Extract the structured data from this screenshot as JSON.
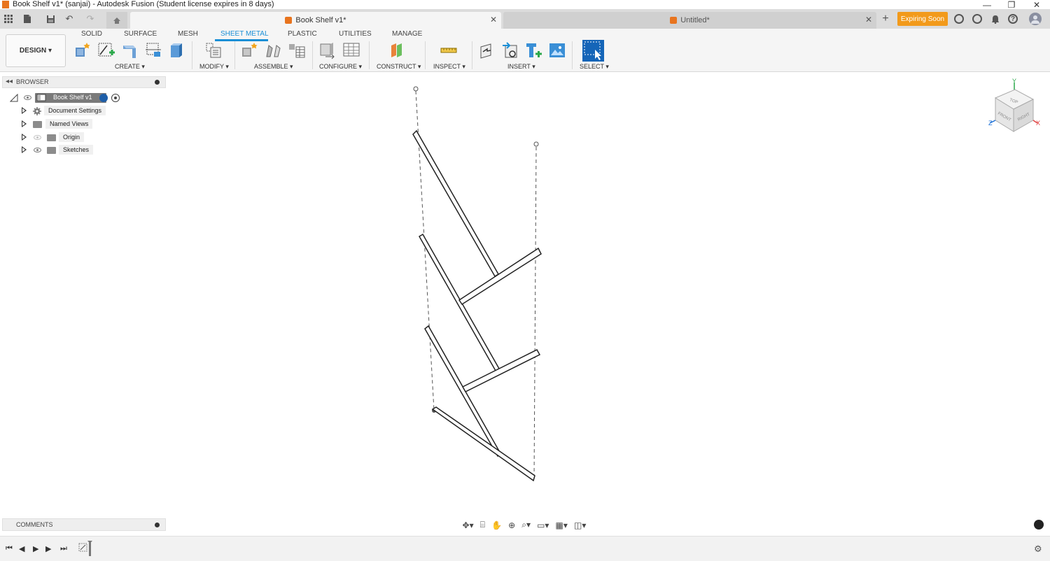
{
  "window": {
    "title": "Book Shelf v1* (sanjai) - Autodesk Fusion (Student license expires in 8 days)",
    "controls": {
      "minimize": "—",
      "restore": "❐",
      "close": "✕"
    }
  },
  "tabbar": {
    "tabs": [
      {
        "label": "Book Shelf v1*",
        "active": true
      },
      {
        "label": "Untitled*",
        "active": false
      }
    ],
    "new_tab": "+",
    "expiring_label": "Expiring Soon"
  },
  "ribbon": {
    "workspace": "DESIGN",
    "tabs": [
      "SOLID",
      "SURFACE",
      "MESH",
      "SHEET METAL",
      "PLASTIC",
      "UTILITIES",
      "MANAGE"
    ],
    "active_tab": "SHEET METAL",
    "groups": {
      "create": "CREATE",
      "modify": "MODIFY",
      "assemble": "ASSEMBLE",
      "configure": "CONFIGURE",
      "construct": "CONSTRUCT",
      "inspect": "INSPECT",
      "insert": "INSERT",
      "select": "SELECT"
    }
  },
  "browser": {
    "title": "BROWSER",
    "root": "Book Shelf v1",
    "items": [
      "Document Settings",
      "Named Views",
      "Origin",
      "Sketches"
    ]
  },
  "viewcube": {
    "top": "TOP",
    "front": "FRONT",
    "right": "RIGHT",
    "axis_x": "X",
    "axis_y": "Y",
    "axis_z": "Z"
  },
  "comments": {
    "title": "COMMENTS"
  },
  "colors": {
    "accent": "#1a8fd6",
    "expiring": "#f29a1b",
    "brand": "#e8741e"
  }
}
